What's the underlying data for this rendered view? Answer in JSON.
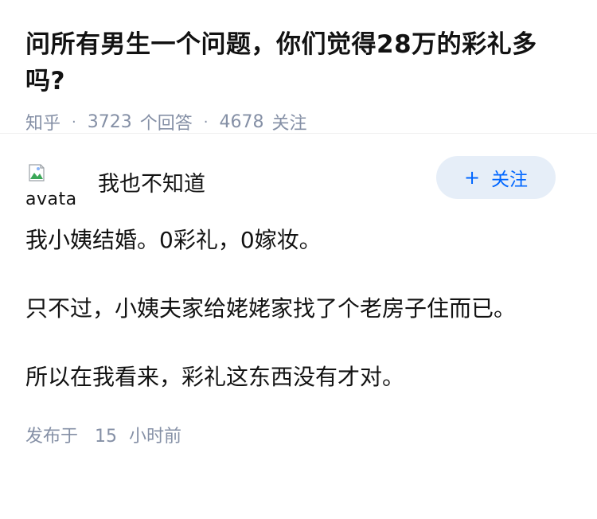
{
  "question": {
    "title": "问所有男生一个问题，你们觉得28万的彩礼多吗?",
    "source": "知乎",
    "answers_count": "3723",
    "answers_label": "个回答",
    "followers_count": "4678",
    "followers_label": "关注",
    "separator": "·"
  },
  "answer": {
    "avatar_alt": "avatar",
    "avatar_icon": "broken-image-icon",
    "author_name": "我也不知道",
    "follow_button": {
      "plus": "+",
      "label": "关注"
    },
    "paragraphs": [
      "我小姨结婚。0彩礼，0嫁妆。",
      "只不过，小姨夫家给姥姥家找了个老房子住而已。",
      "所以在我看来，彩礼这东西没有才对。"
    ],
    "published_prefix": "发布于",
    "published_value": "15",
    "published_unit": "小时前"
  },
  "colors": {
    "text": "#121212",
    "meta": "#8590a6",
    "accent": "#0066ff",
    "button_bg": "#e6eef8"
  }
}
